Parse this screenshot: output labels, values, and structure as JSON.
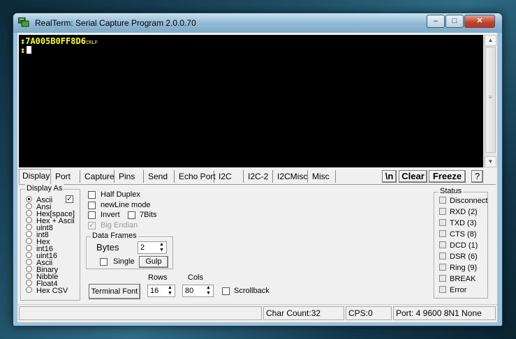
{
  "window": {
    "title": "RealTerm: Serial Capture Program 2.0.0.70",
    "icon": "realterm-app-icon",
    "controls": {
      "minimize": "–",
      "maximize": "□",
      "close": "✕"
    }
  },
  "terminal": {
    "line1_prefix": "↕",
    "line1_data": "7A005B0FF8D6",
    "line1_ctrl": "CRLF",
    "line2_prefix": "↕"
  },
  "tabs": [
    "Display",
    "Port",
    "Capture",
    "Pins",
    "Send",
    "Echo Port",
    "I2C",
    "I2C-2",
    "I2CMisc",
    "Misc"
  ],
  "toolbar_buttons": {
    "newline": "\\n",
    "clear": "Clear",
    "freeze": "Freeze",
    "help": "?"
  },
  "display_as": {
    "label": "Display As",
    "selected": "Ascii",
    "options": [
      "Ascii",
      "Ansi",
      "Hex[space]",
      "Hex + Ascii",
      "uint8",
      "int8",
      "Hex",
      "int16",
      "uint16",
      "Ascii",
      "Binary",
      "Nibble",
      "Float4",
      "Hex CSV"
    ],
    "checked": true
  },
  "options": {
    "half_duplex": "Half Duplex",
    "newline_mode": "newLine mode",
    "invert": "Invert",
    "seven_bits": "7Bits",
    "big_endian": "Big Endian"
  },
  "data_frames": {
    "label": "Data Frames",
    "bytes_label": "Bytes",
    "bytes_value": "2",
    "single_label": "Single",
    "gulp_label": "Gulp"
  },
  "terminal_font_label": "Terminal Font",
  "rows": {
    "label": "Rows",
    "value": "16"
  },
  "cols": {
    "label": "Cols",
    "value": "80"
  },
  "scrollback_label": "Scrollback",
  "status": {
    "label": "Status",
    "items": [
      "Disconnect",
      "RXD (2)",
      "TXD (3)",
      "CTS (8)",
      "DCD (1)",
      "DSR (6)",
      "Ring (9)",
      "BREAK",
      "Error"
    ]
  },
  "statusbar": {
    "char_count": "Char Count:32",
    "cps": "CPS:0",
    "port": "Port: 4 9600 8N1 None"
  },
  "colors": {
    "terminal_bg": "#000000",
    "terminal_text": "#ffff00"
  }
}
